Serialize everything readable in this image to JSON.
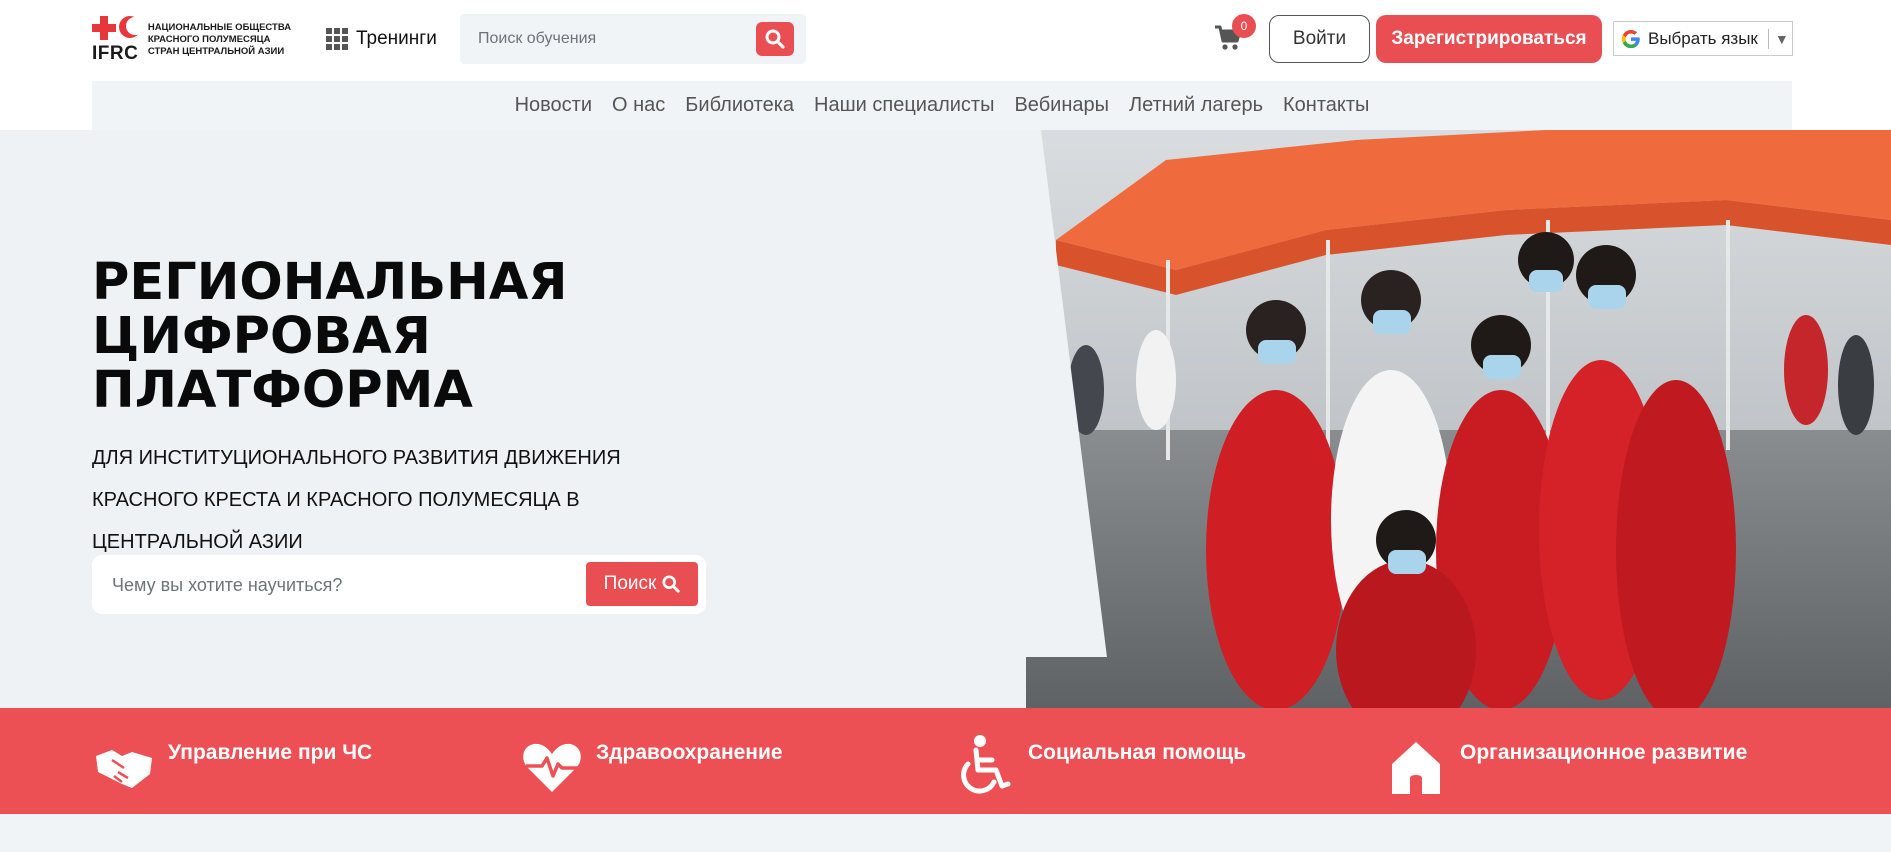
{
  "header": {
    "logo": {
      "abbr": "IFRC",
      "lines": [
        "НАЦИОНАЛЬНЫЕ ОБЩЕСТВА",
        "КРАСНОГО ПОЛУМЕСЯЦА",
        "СТРАН ЦЕНТРАЛЬНОЙ АЗИИ"
      ]
    },
    "trainings_label": "Тренинги",
    "search_placeholder": "Поиск обучения",
    "cart_count": "0",
    "login_label": "Войти",
    "register_label": "Зарегистрироваться",
    "language_label": "Выбрать язык",
    "language_arrow": "▼"
  },
  "nav": {
    "items": [
      "Новости",
      "О нас",
      "Библиотека",
      "Наши специалисты",
      "Вебинары",
      "Летний лагерь",
      "Контакты"
    ]
  },
  "hero": {
    "title_lines": [
      "РЕГИОНАЛЬНАЯ",
      "ЦИФРОВАЯ",
      "ПЛАТФОРМА"
    ],
    "subtitle": "ДЛЯ ИНСТИТУЦИОНАЛЬНОГО РАЗВИТИЯ ДВИЖЕНИЯ КРАСНОГО КРЕСТА И КРАСНОГО ПОЛУМЕСЯЦА В ЦЕНТРАЛЬНОЙ АЗИИ",
    "search_placeholder": "Чему вы хотите научиться?",
    "search_button": "Поиск"
  },
  "categories": [
    {
      "label": "Управление при ЧС",
      "icon": "handshake-icon"
    },
    {
      "label": "Здравоохранение",
      "icon": "heart-pulse-icon"
    },
    {
      "label": "Социальная помощь",
      "icon": "wheelchair-icon"
    },
    {
      "label": "Организационное развитие",
      "icon": "house-icon"
    }
  ],
  "colors": {
    "accent": "#e84e52",
    "band": "#ed5054",
    "background": "#f1f4f6"
  }
}
